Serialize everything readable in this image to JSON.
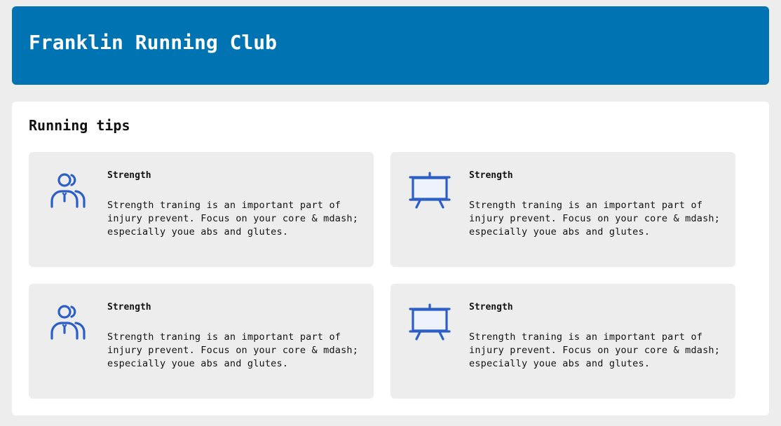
{
  "header": {
    "title": "Franklin Running Club"
  },
  "section": {
    "title": "Running tips"
  },
  "colors": {
    "header_bg": "#0073b2",
    "page_bg": "#ededed",
    "card_bg": "#ededed",
    "icon": "#2c5ec8"
  },
  "cards": [
    {
      "icon": "people-icon",
      "heading": "Strength",
      "text": "Strength traning is an important part of injury prevent. Focus on your core & mdash; especially youe abs and glutes."
    },
    {
      "icon": "presentation-board-icon",
      "heading": "Strength",
      "text": "Strength traning is an important part of injury prevent. Focus on your core & mdash; especially youe abs and glutes."
    },
    {
      "icon": "people-icon",
      "heading": "Strength",
      "text": "Strength traning is an important part of injury prevent. Focus on your core & mdash; especially youe abs and glutes."
    },
    {
      "icon": "presentation-board-icon",
      "heading": "Strength",
      "text": "Strength traning is an important part of injury prevent. Focus on your core & mdash; especially youe abs and glutes."
    }
  ]
}
